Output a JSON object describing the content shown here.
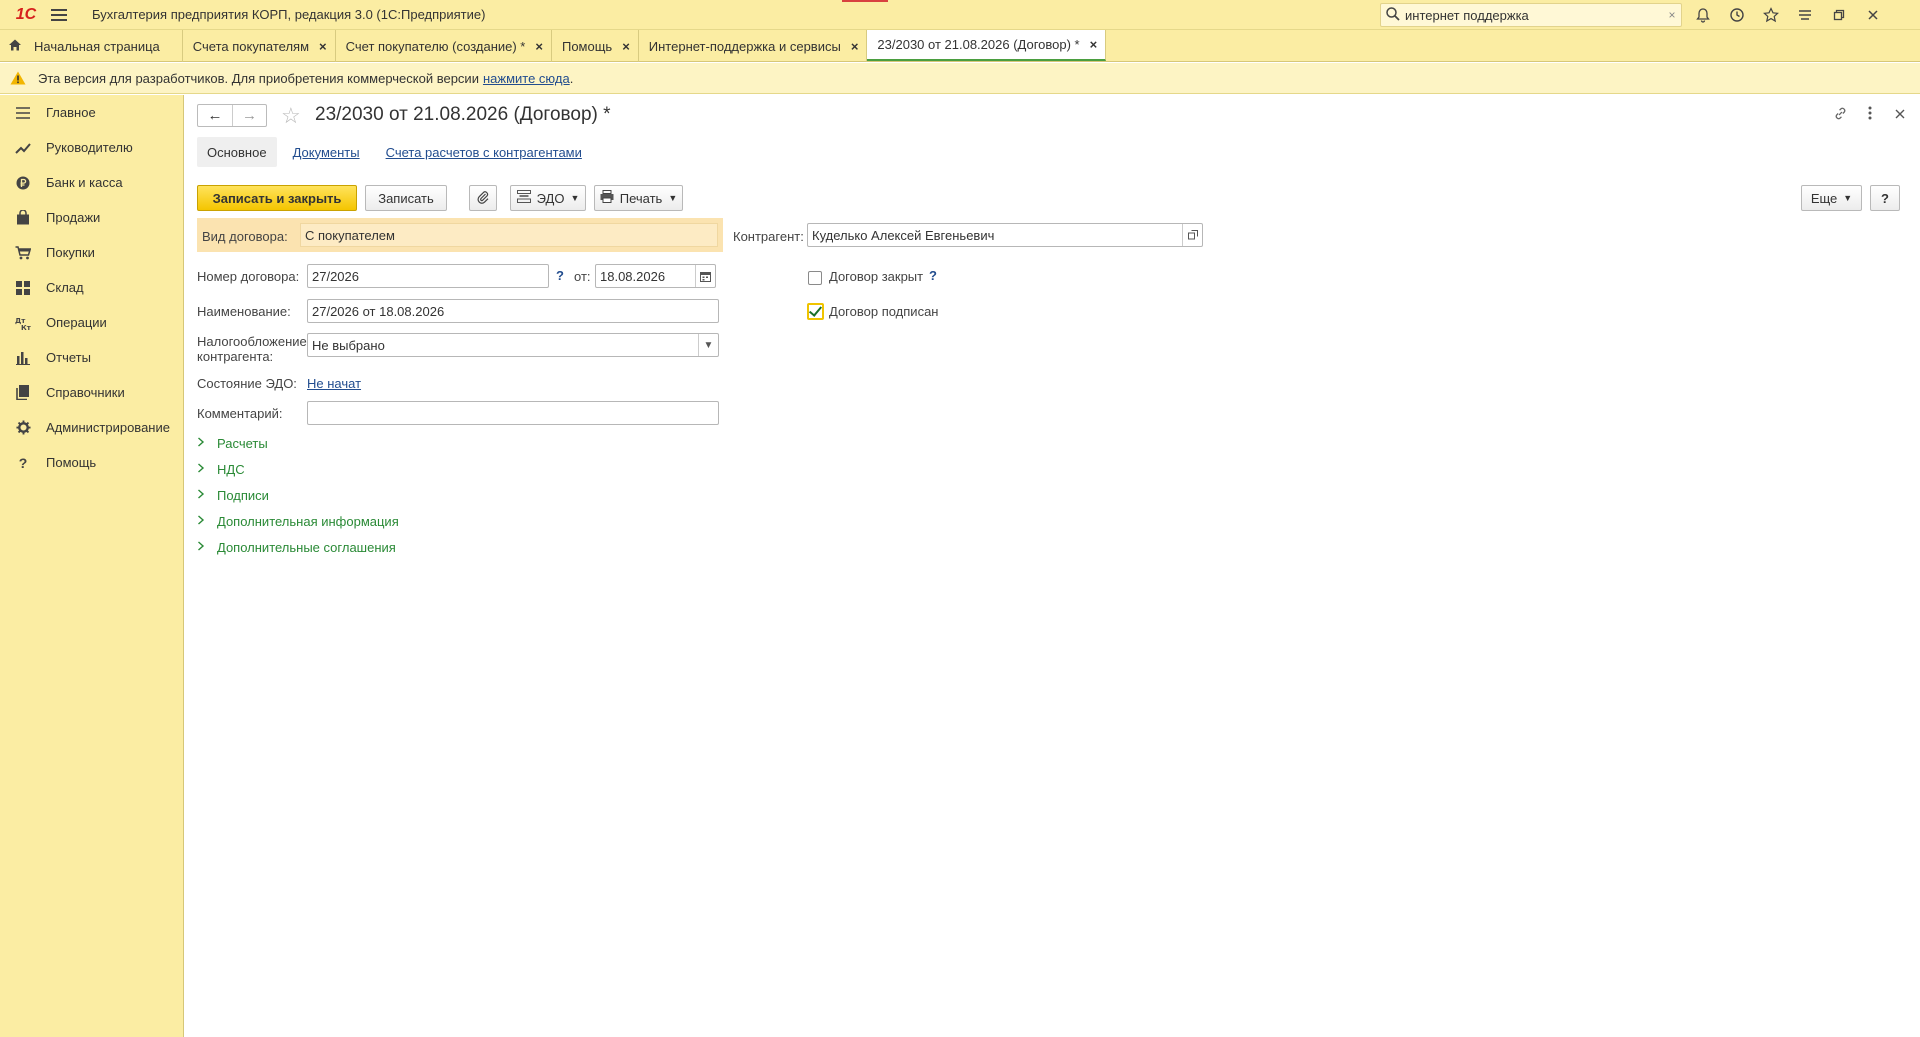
{
  "app": {
    "logo": "1С",
    "title": "Бухгалтерия предприятия КОРП, редакция 3.0  (1С:Предприятие)",
    "search_value": "интернет поддержка",
    "search_clear": "×"
  },
  "titlebar_icons": [
    "bell-icon",
    "history-icon",
    "star-icon",
    "menu-lines-icon",
    "restore-icon",
    "close-icon"
  ],
  "tabs": [
    {
      "label": "Начальная страница"
    },
    {
      "label": "Счета покупателям"
    },
    {
      "label": "Счет покупателю (создание) *"
    },
    {
      "label": "Помощь"
    },
    {
      "label": "Интернет-поддержка и сервисы"
    },
    {
      "label": "23/2030 от 21.08.2026 (Договор) *"
    }
  ],
  "tab_close": "×",
  "notice": {
    "text": "Эта версия для разработчиков. Для приобретения коммерческой версии",
    "link": "нажмите сюда",
    "tail": "."
  },
  "sidebar": {
    "items": [
      {
        "label": "Главное",
        "icon": "menu-icon"
      },
      {
        "label": "Руководителю",
        "icon": "trend-icon"
      },
      {
        "label": "Банк и касса",
        "icon": "ruble-icon"
      },
      {
        "label": "Продажи",
        "icon": "bag-icon"
      },
      {
        "label": "Покупки",
        "icon": "cart-icon"
      },
      {
        "label": "Склад",
        "icon": "grid-icon"
      },
      {
        "label": "Операции",
        "icon": "dt-kt-icon"
      },
      {
        "label": "Отчеты",
        "icon": "bars-icon"
      },
      {
        "label": "Справочники",
        "icon": "book-icon"
      },
      {
        "label": "Администрирование",
        "icon": "gear-icon"
      },
      {
        "label": "Помощь",
        "icon": "question-icon"
      }
    ]
  },
  "doc": {
    "title": "23/2030 от 21.08.2026 (Договор) *",
    "subtabs": [
      "Основное",
      "Документы",
      "Счета расчетов с контрагентами"
    ]
  },
  "toolbar": {
    "save_close": "Записать и закрыть",
    "save": "Записать",
    "edo": "ЭДО",
    "print": "Печать",
    "more": "Еще",
    "help": "?"
  },
  "form": {
    "contract_type_label": "Вид договора:",
    "contract_type_value": "С покупателем",
    "counterparty_label": "Контрагент:",
    "counterparty_value": "Куделько Алексей Евгеньевич",
    "number_label": "Номер договора:",
    "number_value": "27/2026",
    "number_help": "?",
    "date_label": "от:",
    "date_value": "18.08.2026",
    "closed_label": "Договор закрыт",
    "closed_help": "?",
    "closed_checked": false,
    "name_label": "Наименование:",
    "name_value": "27/2026 от 18.08.2026",
    "signed_label": "Договор подписан",
    "signed_checked": true,
    "tax_label_1": "Налогообложение",
    "tax_label_2": "контрагента:",
    "tax_value": "Не выбрано",
    "edo_state_label": "Состояние ЭДО:",
    "edo_state_value": "Не начат",
    "comment_label": "Комментарий:",
    "comment_value": ""
  },
  "groups": [
    "Расчеты",
    "НДС",
    "Подписи",
    "Дополнительная информация",
    "Дополнительные соглашения"
  ]
}
